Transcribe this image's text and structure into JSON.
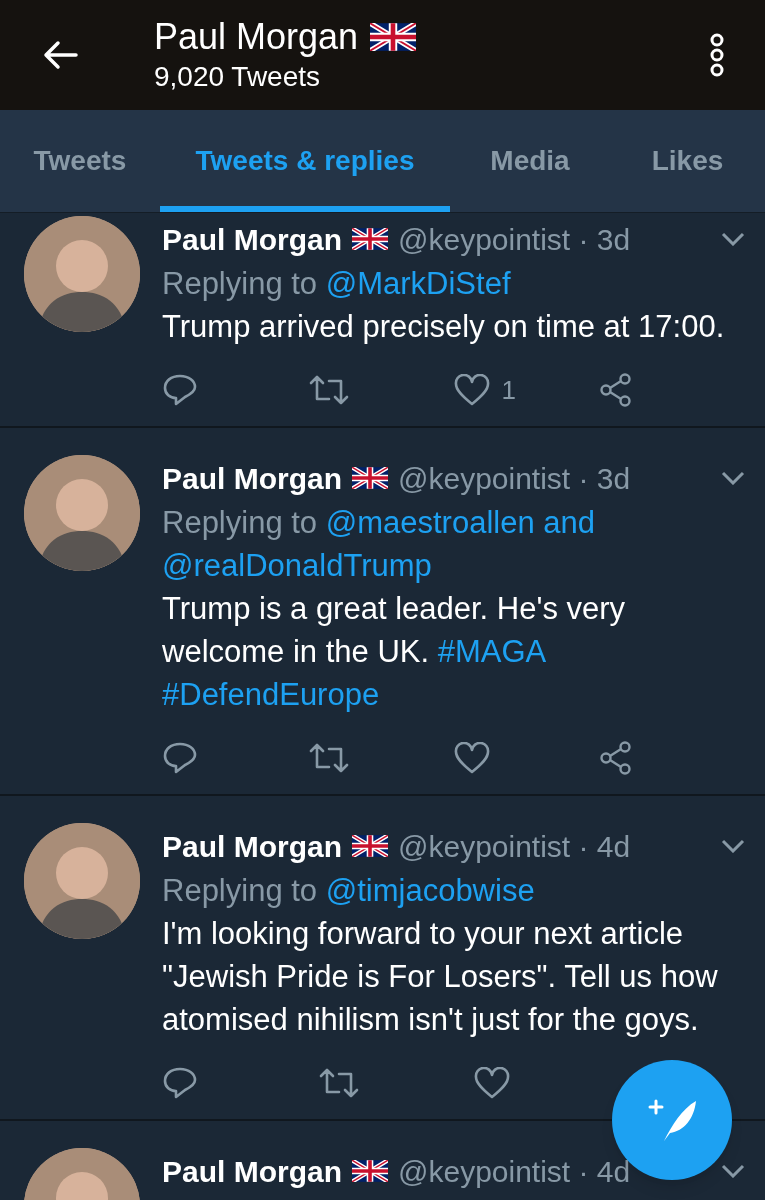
{
  "header": {
    "title": "Paul Morgan",
    "subtitle": "9,020 Tweets"
  },
  "tabs": [
    {
      "label": "Tweets",
      "selected": false
    },
    {
      "label": "Tweets & replies",
      "selected": true
    },
    {
      "label": "Media",
      "selected": false
    },
    {
      "label": "Likes",
      "selected": false
    }
  ],
  "tweets": [
    {
      "name": "Paul Morgan",
      "meta": "@keypointist · 3d",
      "replying": [
        {
          "kind": "text",
          "text": "Replying to"
        },
        {
          "kind": "link",
          "text": "@MarkDiStef"
        }
      ],
      "body": [
        {
          "kind": "text",
          "text": "Trump arrived precisely on time at 17:00."
        }
      ],
      "likes": "1",
      "actions": [
        {
          "kind": "reply"
        },
        {
          "kind": "retweet"
        },
        {
          "kind": "like"
        },
        {
          "kind": "share"
        }
      ]
    },
    {
      "name": "Paul Morgan",
      "meta": "@keypointist · 3d",
      "replying": [
        {
          "kind": "text",
          "text": "Replying to"
        },
        {
          "kind": "link",
          "text": "@maestroallen"
        },
        {
          "kind": "link",
          "text": "and"
        },
        {
          "kind": "link",
          "text": "@realDonaldTrump"
        }
      ],
      "body": [
        {
          "kind": "text",
          "text": "Trump is a great leader. He's very welcome in the UK."
        },
        {
          "kind": "link",
          "text": "#MAGA"
        },
        {
          "kind": "link",
          "text": "#DefendEurope"
        }
      ],
      "actions": [
        {
          "kind": "reply"
        },
        {
          "kind": "retweet"
        },
        {
          "kind": "like"
        },
        {
          "kind": "share"
        }
      ]
    },
    {
      "name": "Paul Morgan",
      "meta": "@keypointist · 4d",
      "replying": [
        {
          "kind": "text",
          "text": "Replying to"
        },
        {
          "kind": "link",
          "text": "@timjacobwise"
        }
      ],
      "body": [
        {
          "kind": "text",
          "text": "I'm looking forward to your next article \"Jewish Pride is For Losers\". Tell us how atomised nihilism isn't just for the goys."
        }
      ],
      "actions": [
        {
          "kind": "reply"
        },
        {
          "kind": "retweet"
        },
        {
          "kind": "like"
        }
      ]
    },
    {
      "name": "Paul Morgan",
      "meta": "@keypointist · 4d"
    }
  ]
}
